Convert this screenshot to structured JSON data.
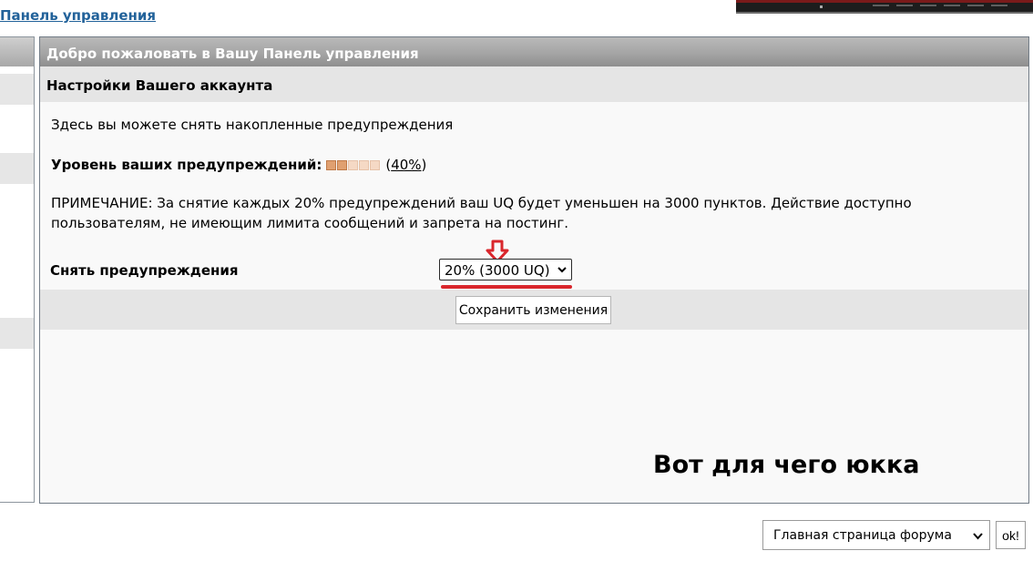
{
  "top_link": "Панель управления",
  "panel": {
    "header": "Добро пожаловать в Вашу Панель управления",
    "section_title": "Настройки Вашего аккаунта",
    "intro": "Здесь вы можете снять накопленные предупреждения",
    "level_label": "Уровень ваших предупреждений:",
    "level_percent": "40%",
    "level_fraction": 0.4,
    "level_open": "(",
    "level_close": ")",
    "note": "ПРИМЕЧАНИЕ: За снятие каждых 20% предупреждений ваш UQ будет уменьшен на 3000 пунктов. Действие доступно пользователям, не имеющим лимита сообщений и запрета на постинг.",
    "remove_label": "Снять предупреждения",
    "remove_select_value": "20% (3000 UQ)",
    "save_button": "Сохранить изменения"
  },
  "caption": "Вот для чего юкка",
  "footer": {
    "forum_select_value": "Главная страница форума",
    "ok_button": "ok!"
  },
  "colors": {
    "link": "#22629a",
    "warning_on": "#e0a070",
    "warning_off": "#f5d9c5",
    "annotation_red": "#d9262c"
  }
}
